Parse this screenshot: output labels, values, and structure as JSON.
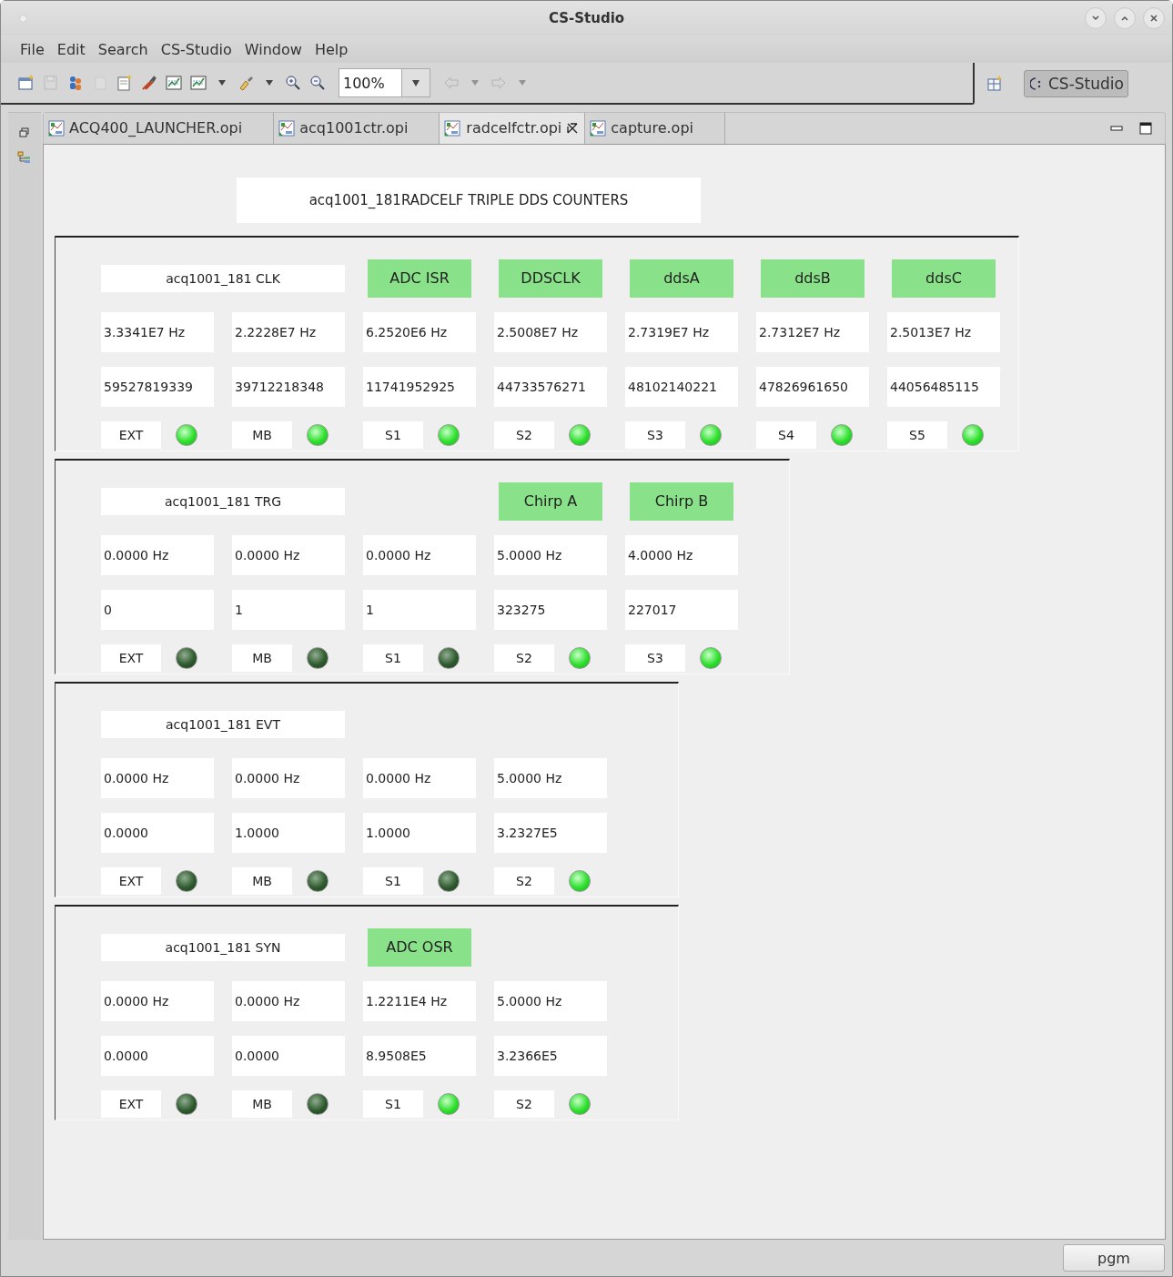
{
  "window": {
    "title": "CS-Studio"
  },
  "menu": [
    "File",
    "Edit",
    "Search",
    "CS-Studio",
    "Window",
    "Help"
  ],
  "toolbar": [
    {
      "kind": "new-window",
      "disabled": false
    },
    {
      "kind": "save",
      "disabled": true
    },
    {
      "kind": "users",
      "disabled": false
    },
    {
      "kind": "print",
      "disabled": true
    },
    {
      "kind": "new-file",
      "disabled": false
    },
    {
      "kind": "tool",
      "disabled": false
    },
    {
      "kind": "chart",
      "disabled": false
    },
    {
      "kind": "chart",
      "disabled": false
    },
    {
      "kind": "caret",
      "disabled": false
    },
    {
      "kind": "brush",
      "disabled": false
    },
    {
      "kind": "caret",
      "disabled": false
    },
    {
      "kind": "zoom-in",
      "disabled": false
    },
    {
      "kind": "zoom-out",
      "disabled": false
    },
    {
      "kind": "zoom-combo",
      "disabled": false,
      "value": "100%"
    },
    {
      "kind": "back",
      "disabled": true
    },
    {
      "kind": "caret",
      "disabled": true
    },
    {
      "kind": "forward",
      "disabled": true
    },
    {
      "kind": "caret",
      "disabled": true
    }
  ],
  "perspective": {
    "label": "CS-Studio",
    "selected": true
  },
  "tabs": [
    {
      "label": "ACQ400_LAUNCHER.opi",
      "selected": false
    },
    {
      "label": "acq1001ctr.opi",
      "selected": false
    },
    {
      "label": "radcelfctr.opi",
      "selected": true
    },
    {
      "label": "capture.opi",
      "selected": false
    }
  ],
  "display": {
    "title": "acq1001_181RADCELF TRIPLE DDS COUNTERS",
    "panels": [
      {
        "title": "acq1001_181 CLK",
        "channels": [
          {
            "rate": "3.3341E7 Hz",
            "count": "59527819339",
            "source": "EXT",
            "on": true
          },
          {
            "rate": "2.2228E7 Hz",
            "count": "39712218348",
            "source": "MB",
            "on": true
          },
          {
            "header": "ADC ISR",
            "rate": "6.2520E6 Hz",
            "count": "11741952925",
            "source": "S1",
            "on": true
          },
          {
            "header": "DDSCLK",
            "rate": "2.5008E7 Hz",
            "count": "44733576271",
            "source": "S2",
            "on": true
          },
          {
            "header": "ddsA",
            "rate": "2.7319E7 Hz",
            "count": "48102140221",
            "source": "S3",
            "on": true
          },
          {
            "header": "ddsB",
            "rate": "2.7312E7 Hz",
            "count": "47826961650",
            "source": "S4",
            "on": true
          },
          {
            "header": "ddsC",
            "rate": "2.5013E7 Hz",
            "count": "44056485115",
            "source": "S5",
            "on": true
          }
        ]
      },
      {
        "title": "acq1001_181 TRG",
        "channels": [
          {
            "rate": "0.0000 Hz",
            "count": "0",
            "source": "EXT",
            "on": false
          },
          {
            "rate": "0.0000 Hz",
            "count": "1",
            "source": "MB",
            "on": false
          },
          {
            "rate": "0.0000 Hz",
            "count": "1",
            "source": "S1",
            "on": false
          },
          {
            "header": "Chirp A",
            "rate": "5.0000 Hz",
            "count": "323275",
            "source": "S2",
            "on": true
          },
          {
            "header": "Chirp B",
            "rate": "4.0000 Hz",
            "count": "227017",
            "source": "S3",
            "on": true
          }
        ]
      },
      {
        "title": "acq1001_181 EVT",
        "channels": [
          {
            "rate": "0.0000 Hz",
            "count": "0.0000",
            "source": "EXT",
            "on": false
          },
          {
            "rate": "0.0000 Hz",
            "count": "1.0000",
            "source": "MB",
            "on": false
          },
          {
            "rate": "0.0000 Hz",
            "count": "1.0000",
            "source": "S1",
            "on": false
          },
          {
            "rate": "5.0000 Hz",
            "count": "3.2327E5",
            "source": "S2",
            "on": true
          }
        ]
      },
      {
        "title": "acq1001_181 SYN",
        "channels": [
          {
            "rate": "0.0000 Hz",
            "count": "0.0000",
            "source": "EXT",
            "on": false
          },
          {
            "rate": "0.0000 Hz",
            "count": "0.0000",
            "source": "MB",
            "on": false
          },
          {
            "header": "ADC OSR",
            "rate": "1.2211E4 Hz",
            "count": "8.9508E5",
            "source": "S1",
            "on": true
          },
          {
            "rate": "5.0000 Hz",
            "count": "3.2366E5",
            "source": "S2",
            "on": true
          }
        ]
      }
    ]
  },
  "status_bar": {
    "button": "pgm"
  }
}
